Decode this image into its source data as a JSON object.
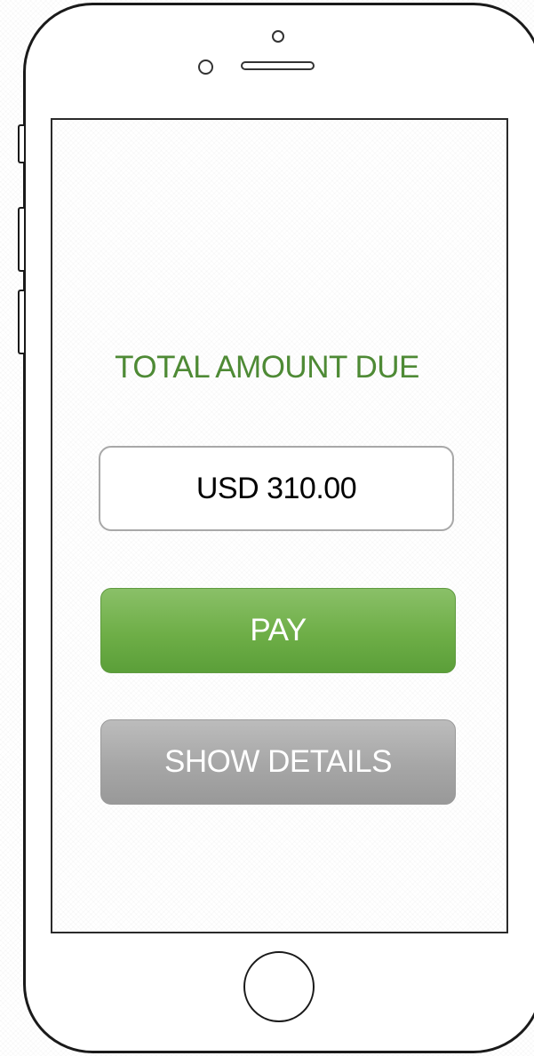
{
  "screen": {
    "title": "TOTAL AMOUNT DUE",
    "amount": "USD 310.00",
    "pay_button_label": "PAY",
    "show_details_button_label": "SHOW DETAILS"
  },
  "colors": {
    "title_text": "#4e8a35",
    "pay_button": "#6eae47",
    "details_button": "#a6a6a6"
  }
}
